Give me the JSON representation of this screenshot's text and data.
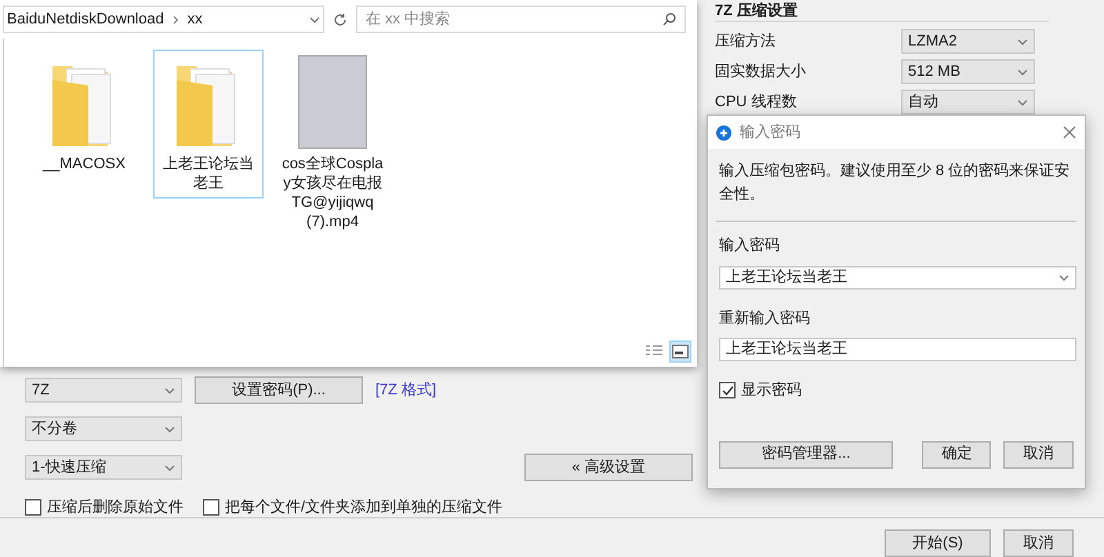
{
  "compress_settings": {
    "title": "7Z 压缩设置",
    "rows": [
      {
        "label": "压缩方法",
        "value": "LZMA2"
      },
      {
        "label": "固实数据大小",
        "value": "512 MB"
      },
      {
        "label": "CPU 线程数",
        "value": "自动"
      }
    ]
  },
  "explorer": {
    "breadcrumb": [
      "BaiduNetdiskDownload",
      "xx"
    ],
    "search": {
      "placeholder": "在 xx 中搜索"
    },
    "items": [
      {
        "kind": "folder",
        "name": "__MACOSX",
        "selected": false
      },
      {
        "kind": "folder",
        "name": "上老王论坛当老王",
        "selected": true
      },
      {
        "kind": "video",
        "name": "cos全球Cosplay女孩尽在电报TG@yijiqwq(7).mp4",
        "selected": false
      }
    ],
    "views": [
      {
        "kind": "details",
        "selected": false
      },
      {
        "kind": "large-icons",
        "selected": true
      }
    ]
  },
  "options": {
    "format": "7Z",
    "split": "不分卷",
    "level": "1-快速压缩",
    "password_button": "设置密码(P)...",
    "format_link": "[7Z 格式]",
    "advanced_button": "« 高级设置",
    "checkboxes": [
      {
        "label": "压缩后删除原始文件",
        "checked": false
      },
      {
        "label": "把每个文件/文件夹添加到单独的压缩文件",
        "checked": false
      }
    ]
  },
  "password_dialog": {
    "title": "输入密码",
    "hint": "输入压缩包密码。建议使用至少 8 位的密码来保证安全性。",
    "password_label": "输入密码",
    "password": "上老王论坛当老王",
    "repeat_label": "重新输入密码",
    "repeat": "上老王论坛当老王",
    "show_password": {
      "label": "显示密码",
      "checked": true
    },
    "buttons": [
      "密码管理器...",
      "确定",
      "取消"
    ]
  },
  "buttons": [
    "开始(S)",
    "取消"
  ]
}
